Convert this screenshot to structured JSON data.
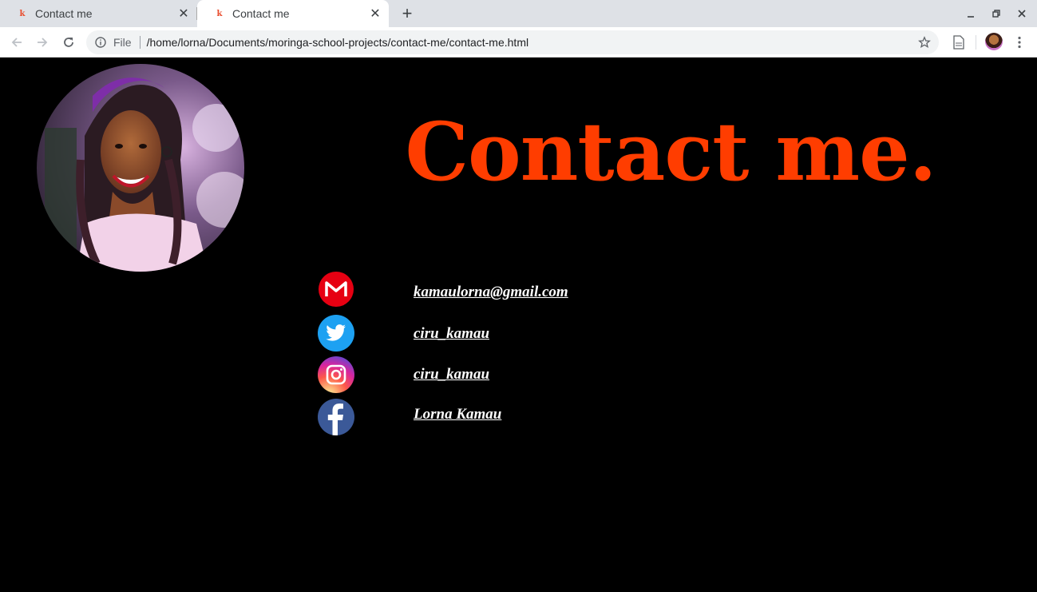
{
  "browser": {
    "tabs": [
      {
        "title": "Contact me",
        "active": false
      },
      {
        "title": "Contact me",
        "active": true
      }
    ],
    "favicon_glyph": "k",
    "address": {
      "scheme_label": "File",
      "url": "/home/lorna/Documents/moringa-school-projects/contact-me/contact-me.html"
    }
  },
  "page": {
    "heading": "Contact me.",
    "heading_color": "#ff3d00",
    "contacts": [
      {
        "icon": "gmail-icon",
        "text": "kamaulorna@gmail.com",
        "color": "#e60012"
      },
      {
        "icon": "twitter-icon",
        "text": "ciru_kamau",
        "color": "#1da1f2"
      },
      {
        "icon": "instagram-icon",
        "text": "ciru_kamau",
        "color": "#e1306c"
      },
      {
        "icon": "facebook-icon",
        "text": "Lorna Kamau",
        "color": "#3b5998"
      }
    ]
  }
}
